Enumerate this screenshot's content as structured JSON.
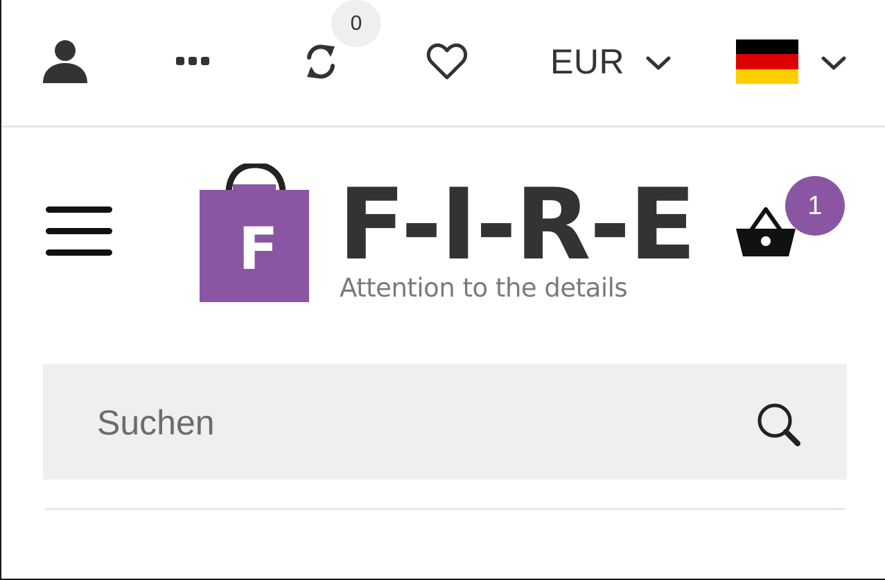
{
  "topbar": {
    "compare_count": "0",
    "currency": {
      "selected": "EUR"
    },
    "language": {
      "flag_icon": "germany-flag-icon",
      "flag_colors": [
        "#000000",
        "#dd0000",
        "#ffce00"
      ]
    },
    "icons": [
      "user-icon",
      "more-icon",
      "compare-icon",
      "wishlist-heart-icon",
      "chevron-down-icon"
    ]
  },
  "header": {
    "logo": {
      "bag_letter": "F",
      "wordmark": "F-I-R-E",
      "tagline": "Attention to the details",
      "brand_color": "#8a56a3"
    },
    "cart": {
      "count": "1",
      "icon": "basket-icon"
    },
    "menu_icon": "hamburger-menu-icon"
  },
  "search": {
    "placeholder": "Suchen",
    "value": "",
    "icon": "search-icon"
  },
  "colors": {
    "accent": "#8a56a3",
    "text": "#333333",
    "search_bg": "#efefef"
  }
}
